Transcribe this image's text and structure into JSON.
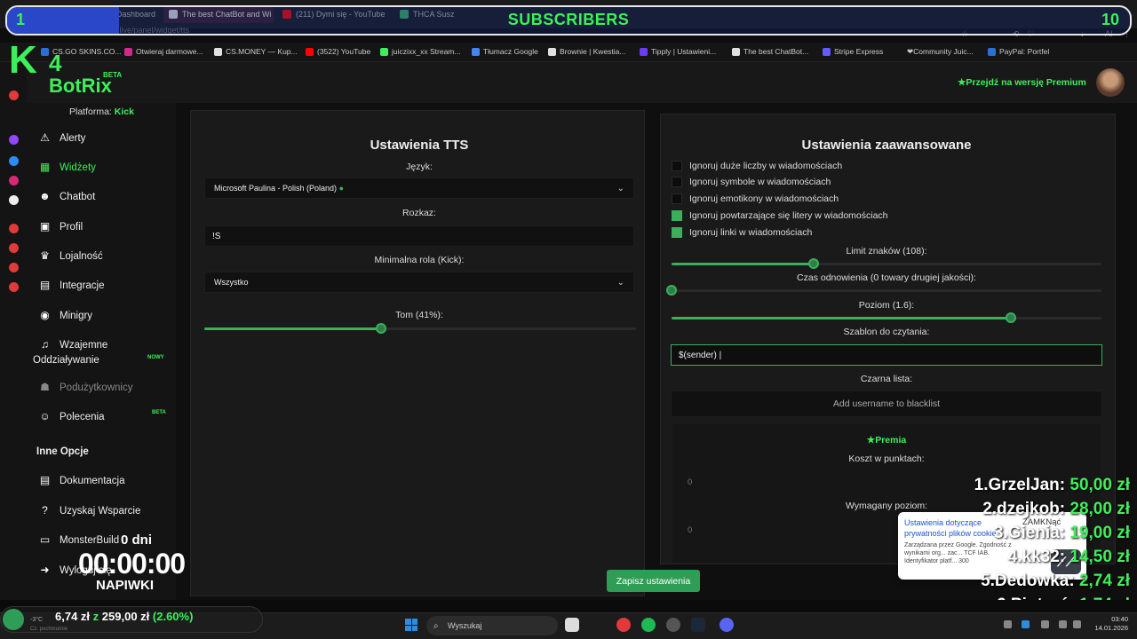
{
  "browser": {
    "tabs": [
      {
        "label": "Dashboard",
        "favicon_color": "#555555"
      },
      {
        "label": "The best ChatBot and Wi",
        "favicon_color": "#e0e0e0"
      },
      {
        "label": "(211) Dymi się - YouTube",
        "favicon_color": "#ff0000"
      },
      {
        "label": "THCA Susz",
        "favicon_color": "#3aaf5c"
      }
    ],
    "url": "botrix.live/panel/widget/tts",
    "bookmarks": [
      {
        "label": "CS.GO SKINS.CO...",
        "color": "#2a6fd6"
      },
      {
        "label": "Otwieraj darmowe...",
        "color": "#d12a8a"
      },
      {
        "label": "CS.MONEY — Kup...",
        "color": "#e0e0e0"
      },
      {
        "label": "(3522) YouTube",
        "color": "#ff0000"
      },
      {
        "label": "juiczixx_xx Stream...",
        "color": "#3df05a"
      },
      {
        "label": "Tłumacz Google",
        "color": "#4285f4"
      },
      {
        "label": "Brownie | Kwestia...",
        "color": "#e0e0e0"
      },
      {
        "label": "Tipply | Ustawieni...",
        "color": "#6a3df0"
      },
      {
        "label": "The best ChatBot...",
        "color": "#e0e0e0"
      },
      {
        "label": "Stripe Express",
        "color": "#635bff"
      },
      {
        "label": "❤Community Juic...",
        "color": "#e05555"
      },
      {
        "label": "PayPal: Portfel",
        "color": "#2a6fd6"
      }
    ]
  },
  "subs_goal": {
    "title": "SUBSCRIBERS",
    "current": "1",
    "target": "10",
    "progress": 0.1
  },
  "logo": {
    "k": "K",
    "four": "4",
    "name": "BotRix",
    "beta": "BETA"
  },
  "header": {
    "premium_link": "★Przejdź na wersję Premium"
  },
  "sidebar": {
    "platform_label": "Platforma:",
    "platform_value": "Kick",
    "items": [
      {
        "label": "Alerty",
        "icon": "⚠"
      },
      {
        "label": "Widżety",
        "icon": "▦"
      },
      {
        "label": "Chatbot",
        "icon": "☻"
      },
      {
        "label": "Profil",
        "icon": "▣"
      },
      {
        "label": "Lojalność",
        "icon": "♛"
      },
      {
        "label": "Integracje",
        "icon": "▤"
      },
      {
        "label": "Minigry",
        "icon": "◉"
      },
      {
        "label": "Wzajemne",
        "label2": "Oddziaływanie",
        "icon": "♫",
        "badge": "NOWY"
      },
      {
        "label": "Podużytkownicy",
        "icon": "☗"
      },
      {
        "label": "Polecenia",
        "icon": "☺",
        "badge": "BETA"
      }
    ],
    "other_heading": "Inne Opcje",
    "other_items": [
      {
        "label": "Dokumentacja",
        "icon": "▤"
      },
      {
        "label": "Uzyskaj Wsparcie",
        "icon": "?"
      },
      {
        "label": "MonsterBuild",
        "icon": "▭"
      },
      {
        "label": "Wyloguj się",
        "icon": "➜"
      }
    ]
  },
  "tts": {
    "title": "Ustawienia TTS",
    "language_label": "Język:",
    "language_value": "Microsoft Paulina - Polish (Poland)",
    "command_label": "Rozkaz:",
    "command_value": "!S",
    "role_label": "Minimalna rola (Kick):",
    "role_value": "Wszystko",
    "volume_label": "Tom (41%):",
    "volume": 0.41
  },
  "advanced": {
    "title": "Ustawienia zaawansowane",
    "checkboxes": [
      {
        "label": "Ignoruj duże liczby w wiadomościach",
        "checked": false
      },
      {
        "label": "Ignoruj symbole w wiadomościach",
        "checked": false
      },
      {
        "label": "Ignoruj emotikony w wiadomościach",
        "checked": false
      },
      {
        "label": "Ignoruj powtarzające się litery w wiadomościach",
        "checked": true
      },
      {
        "label": "Ignoruj linki w wiadomościach",
        "checked": true
      }
    ],
    "char_limit_label": "Limit znaków (108):",
    "char_limit_fraction": 0.33,
    "cooldown_label": "Czas odnowienia (0 towary drugiej jakości):",
    "cooldown_fraction": 0.0,
    "level_label": "Poziom (1.6):",
    "level_fraction": 0.79,
    "template_label": "Szablon do czytania:",
    "template_value": "$(sender) |",
    "blacklist_label": "Czarna lista:",
    "blacklist_placeholder": "Add username to blacklist",
    "premium_heading": "★Premia",
    "cost_label": "Koszt w punktach:",
    "cost_value": "0",
    "required_level_label": "Wymagany poziom:",
    "required_level_value": "0"
  },
  "save_button": "Zapisz ustawienia",
  "overlay_timer": {
    "days": "0 dni",
    "clock": "00:00:00",
    "label": "NAPIWKI"
  },
  "leaderboard": [
    {
      "rank": "1.",
      "name": "GrzelJan:",
      "amount": "50,00 zł"
    },
    {
      "rank": "2.",
      "name": "dzejkob:",
      "amount": "28,00 zł"
    },
    {
      "rank": "3.",
      "name": "Gienia:",
      "amount": "19,00 zł"
    },
    {
      "rank": "4.",
      "name": "kk32:",
      "amount": "14,50 zł"
    },
    {
      "rank": "5.",
      "name": "Dedowka:",
      "amount": "2,74 zł"
    },
    {
      "rank": "6.",
      "name": "Piotruś:",
      "amount": "1,74 zł"
    }
  ],
  "popup": {
    "title": "Ustawienia dotyczące prywatności plików cookie",
    "close": "ZAMKNąć",
    "body": "Zarządzana przez Google. Zgodność z wynikami org... zac... TCF IAB. Identyfikator platf... 300"
  },
  "donation": {
    "current": "6,74 zł",
    "sep": "z",
    "goal": "259,00 zł",
    "percent": "(2.60%)"
  },
  "weather": {
    "temp": "-3°C",
    "desc": "Cz. pochmurnie"
  },
  "taskbar": {
    "search_placeholder": "Wyszukaj",
    "time": "03:40",
    "date": "14.01.2026"
  }
}
